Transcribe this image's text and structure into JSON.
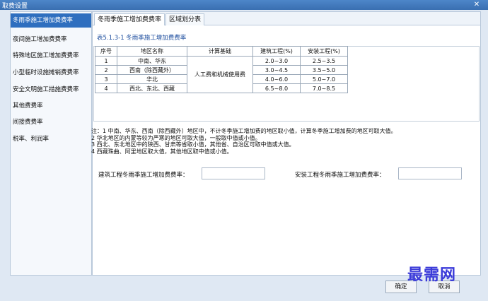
{
  "window": {
    "title": "取费设置",
    "close_glyph": "✕"
  },
  "sidebar": {
    "items": [
      {
        "label": "冬雨季施工增加费费率",
        "active": true
      },
      {
        "label": "夜间施工增加费费率"
      },
      {
        "label": "特殊地区施工增加费费率"
      },
      {
        "label": "小型临时设施摊销费费率"
      },
      {
        "label": "安全文明施工措施费费率"
      },
      {
        "label": "其他费费率"
      },
      {
        "label": "间接费费率"
      },
      {
        "label": "税率、利润率"
      }
    ]
  },
  "tabs": [
    {
      "label": "冬雨季施工增加费费率",
      "active": true
    },
    {
      "label": "区域划分表"
    }
  ],
  "table": {
    "caption": "表5.1.3-1  冬雨季施工增加费费率",
    "headers": [
      "序号",
      "地区名称",
      "计算基础",
      "建筑工程(%)",
      "安装工程(%)"
    ],
    "calc_basis": "人工费和机械使用费",
    "rows": [
      {
        "no": "1",
        "region": "中南、华东",
        "build": "2.0~3.0",
        "install": "2.5~3.5"
      },
      {
        "no": "2",
        "region": "西南（除西藏外）",
        "build": "3.0~4.5",
        "install": "3.5~5.0"
      },
      {
        "no": "3",
        "region": "华北",
        "build": "4.0~6.0",
        "install": "5.0~7.0"
      },
      {
        "no": "4",
        "region": "西北、东北、西藏",
        "build": "6.5~8.0",
        "install": "7.0~8.5"
      }
    ]
  },
  "notes": [
    "注：1 中南、华东、西南（除西藏外）地区中，不计冬季施工增加费的地区取小值，计算冬季施工增加费的地区可取大值。",
    "     2 华北地区的内蒙等较为严寒的地区可取大值，一般取中值或小值。",
    "     3 西北、东北地区中的陕西、甘肃等省取小值，其他省、自治区可取中值或大值。",
    "     4 西藏珠曲、阿里地区取大值，其他地区取中值或小值。"
  ],
  "fields": {
    "build_label": "建筑工程冬雨季施工增加费费率：",
    "build_value": "",
    "install_label": "安装工程冬雨季施工增加费费率：",
    "install_value": ""
  },
  "buttons": {
    "ok": "确定",
    "cancel": "取消"
  },
  "watermark": "最需网"
}
